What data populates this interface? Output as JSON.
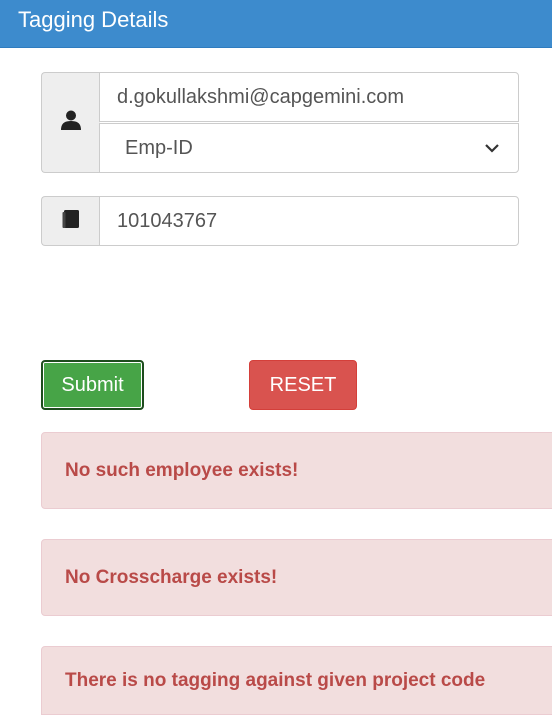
{
  "header": {
    "title": "Tagging Details"
  },
  "form": {
    "email_value": "d.gokullakshmi@capgemini.com",
    "id_type_selected": "Emp-ID",
    "id_value": "101043767",
    "user_icon": "user-icon",
    "book_icon": "book-icon",
    "chevron_icon": "chevron-down-icon"
  },
  "buttons": {
    "submit_label": "Submit",
    "reset_label": "RESET"
  },
  "alerts": [
    {
      "message": "No such employee exists!"
    },
    {
      "message": "No Crosscharge exists!"
    },
    {
      "message": "There is no tagging against given project code"
    }
  ],
  "colors": {
    "header": "#3d8bcd",
    "submit": "#47a447",
    "reset": "#d9534f",
    "alert_bg": "#f2dede",
    "alert_text": "#b94a48"
  }
}
